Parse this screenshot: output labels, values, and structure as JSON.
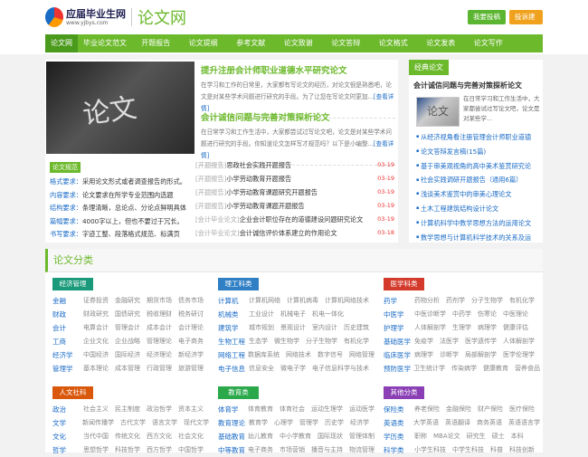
{
  "header": {
    "logo_name": "应届毕业生网",
    "logo_url": "www.yjbys.com",
    "site_title": "论文网",
    "btn_submit": "我要投稿",
    "btn_complain": "投诉建议"
  },
  "colors": {
    "green": "#6cb92c",
    "blue": "#1a6bc6",
    "red_date": "#e33333"
  },
  "nav": [
    "论文网",
    "毕业论文范文",
    "开题报告",
    "论文提纲",
    "参考文献",
    "论文致谢",
    "论文答辩",
    "论文格式",
    "论文发表",
    "论文写作"
  ],
  "hero": {
    "image_text": "论文"
  },
  "articles": [
    {
      "title": "提升注册会计师职业道德水平研究论文",
      "summary": "在学习和工作的日常里，大家都有写论文的经历，对论文很是熟悉吧，论文是对某些学术问题进行研究的手段。为了让您在写论文时更加...",
      "more": "[查看详情]"
    },
    {
      "title": "会计诚信问题与完善对策探析论文",
      "summary": "在日常学习和工作生活中，大家都尝试过写论文吧，论文是对某些学术问题进行研究的手段。你知道论文怎样写才规范吗？以下是小编整...",
      "more": "[查看详情]"
    }
  ],
  "spec": {
    "tag": "论文规范",
    "items": [
      {
        "k": "格式要求：",
        "v": "采用论文形式或者调查报告的形式。"
      },
      {
        "k": "内容要求：",
        "v": "论文要求在所学专业范围内选题"
      },
      {
        "k": "结构要求：",
        "v": "条理清晰，总论点、分论点鲜明具体"
      },
      {
        "k": "篇幅要求：",
        "v": "4000字以上，但也不要过于冗长。"
      },
      {
        "k": "书写要求：",
        "v": "字迹工整、段落格式规范、标满页"
      }
    ]
  },
  "news": [
    {
      "c": "[开题报告]",
      "t": "思政社会实践开题报告",
      "d": "03-19"
    },
    {
      "c": "[开题报告]",
      "t": "小学劳动教育开题报告",
      "d": "03-19"
    },
    {
      "c": "[开题报告]",
      "t": "小学劳动教育课题研究开题报告",
      "d": "03-19"
    },
    {
      "c": "[开题报告]",
      "t": "小学劳动教育课题开题报告",
      "d": "03-19"
    },
    {
      "c": "[会计毕业论文]",
      "t": "企业会计职位存在的道德建设问题研究论文",
      "d": "03-19"
    },
    {
      "c": "[会计毕业论文]",
      "t": "会计诚信评价体系建立的作用论文",
      "d": "03-18"
    }
  ],
  "sidebar": {
    "title": "经典论文",
    "feature_title": "会计诚信问题与完善对策探析论文",
    "feature_image_text": "论文",
    "feature_summary": "在日常学习和工作生活中，大家都尝试过写论文吧，论文是对某些学...",
    "links": [
      "从经济视角看注册管理会计师职业道德",
      "论文答辩发言稿(15篇)",
      "基于审美观视角的高中美术鉴赏研究论",
      "社会实践调研开题报告（通用6篇）",
      "浅谈美术鉴赏中的审美心理论文",
      "土木工程建筑结构设计论文",
      "计算机科学中数学思想方法的运用论文",
      "数学思想与计算机科学技术的关系及运"
    ]
  },
  "categories": {
    "title": "论文分类",
    "boxes": [
      {
        "name": "经济管理",
        "color": "#1a9a7a",
        "rows": [
          {
            "m": "金融",
            "s": [
              "证券投资",
              "金融研究",
              "期货市场",
              "债务市场"
            ]
          },
          {
            "m": "财政",
            "s": [
              "财政研究",
              "国债研究",
              "税收理财",
              "税务研讨"
            ]
          },
          {
            "m": "会计",
            "s": [
              "电算会计",
              "管理会计",
              "成本会计",
              "会计理论"
            ]
          },
          {
            "m": "工商",
            "s": [
              "企业文化",
              "企业战略",
              "管理理论",
              "电子商务"
            ]
          },
          {
            "m": "经济学",
            "s": [
              "中国经济",
              "国际经济",
              "经济理论",
              "新经济学"
            ]
          },
          {
            "m": "管理学",
            "s": [
              "基本理论",
              "成本管理",
              "行政管理",
              "旅游管理"
            ]
          }
        ]
      },
      {
        "name": "理工科类",
        "color": "#2e7fc4",
        "rows": [
          {
            "m": "计算机",
            "s": [
              "计算机网络",
              "计算机病毒",
              "计算机网络技术"
            ]
          },
          {
            "m": "机械类",
            "s": [
              "工业设计",
              "机械电子",
              "机电一体化"
            ]
          },
          {
            "m": "建筑学",
            "s": [
              "城市规划",
              "景观设计",
              "室内设计",
              "历史建筑"
            ]
          },
          {
            "m": "生物工程",
            "s": [
              "生态学",
              "微生物学",
              "分子生物学",
              "有机化学"
            ]
          },
          {
            "m": "网络工程",
            "s": [
              "数据库系统",
              "网络技术",
              "数字信号",
              "网络管理"
            ]
          },
          {
            "m": "电子信息",
            "s": [
              "信息安全",
              "微电子学",
              "电子信息科学与技术"
            ]
          }
        ]
      },
      {
        "name": "医学科类",
        "color": "#d33a2c",
        "rows": [
          {
            "m": "药学",
            "s": [
              "药物分析",
              "药剂学",
              "分子生物学",
              "有机化学"
            ]
          },
          {
            "m": "中医学",
            "s": [
              "中医诊断学",
              "中药学",
              "伤寒论",
              "中医理论"
            ]
          },
          {
            "m": "护理学",
            "s": [
              "人体解剖学",
              "生理学",
              "病理学",
              "健康评估"
            ]
          },
          {
            "m": "基础医学",
            "s": [
              "免疫学",
              "法医学",
              "医学遗传学",
              "人体解剖学"
            ]
          },
          {
            "m": "临床医学",
            "s": [
              "病理学",
              "诊断学",
              "局部解剖学",
              "医学伦理学"
            ]
          },
          {
            "m": "预防医学",
            "s": [
              "卫生统计学",
              "传染病学",
              "健康教育",
              "营养食品"
            ]
          }
        ]
      },
      {
        "name": "人文社科",
        "color": "#d9580c",
        "rows": [
          {
            "m": "政治",
            "s": [
              "社会主义",
              "民主制度",
              "政治哲学",
              "资本主义"
            ]
          },
          {
            "m": "文学",
            "s": [
              "新闻传播学",
              "古代文学",
              "语言文学",
              "现代文学"
            ]
          },
          {
            "m": "文化",
            "s": [
              "当代中国",
              "传统文化",
              "西方文化",
              "社会文化"
            ]
          },
          {
            "m": "哲学",
            "s": [
              "思想哲学",
              "科技哲学",
              "西方哲学",
              "中国哲学"
            ]
          }
        ]
      },
      {
        "name": "教育类",
        "color": "#2aa84a",
        "rows": [
          {
            "m": "体育学",
            "s": [
              "体育教育",
              "体育社会",
              "运动生理学",
              "运动医学"
            ]
          },
          {
            "m": "教育理论",
            "s": [
              "教育学",
              "心理学",
              "管理学",
              "历史学",
              "经济学"
            ]
          },
          {
            "m": "基础教育",
            "s": [
              "幼儿教育",
              "中小学教育",
              "国际现状",
              "管理体制"
            ]
          },
          {
            "m": "中等教育",
            "s": [
              "电子商务",
              "市场营销",
              "播音与主持",
              "物流管理"
            ]
          }
        ]
      },
      {
        "name": "其他分类",
        "color": "#8a3fb5",
        "rows": [
          {
            "m": "保险类",
            "s": [
              "养老保险",
              "金融保险",
              "财产保险",
              "医疗保险"
            ]
          },
          {
            "m": "英语类",
            "s": [
              "大学英语",
              "英语翻译",
              "商务英语",
              "英语语言学"
            ]
          },
          {
            "m": "学历类",
            "s": [
              "职称",
              "MBA论文",
              "研究生",
              "硕士",
              "本科"
            ]
          },
          {
            "m": "科学类",
            "s": [
              "小学生科技",
              "中学生科技",
              "科普",
              "科技创新"
            ]
          }
        ]
      }
    ]
  }
}
